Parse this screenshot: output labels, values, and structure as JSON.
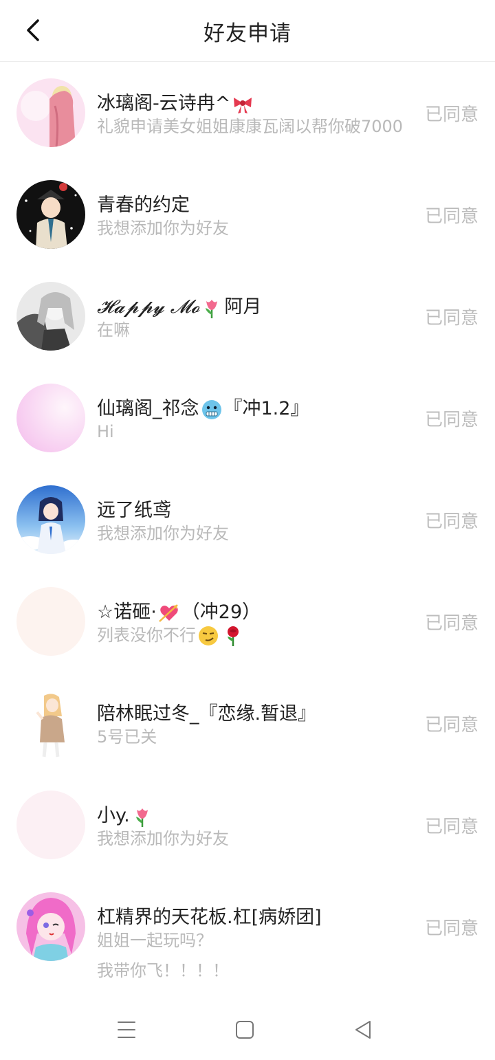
{
  "header": {
    "title": "好友申请"
  },
  "requests": [
    {
      "name": "冰璃阁-云诗冉^",
      "emoji": "🎀",
      "message": "礼貌申请美女姐姐康康瓦阔以帮你破7000",
      "status": "已同意",
      "avatar_color": "#f7c6e0"
    },
    {
      "name": "青春的约定",
      "message": "我想添加你为好友",
      "status": "已同意",
      "avatar_color": "#1a1a1a"
    },
    {
      "name": "𝓗𝓪𝓹𝓹𝔂 𝓜𝓸",
      "emoji": "🌷",
      "name_suffix": "阿月",
      "message": "在嘛",
      "status": "已同意",
      "avatar_color": "#d8d8d8"
    },
    {
      "name": "仙璃阁_祁念",
      "emoji": "🥶",
      "name_suffix": "『冲1.2』",
      "message": "Hi",
      "status": "已同意",
      "avatar_color": "#f8d2f2"
    },
    {
      "name": "远了纸鸢",
      "message": "我想添加你为好友",
      "status": "已同意",
      "avatar_color": "#3a7bd5"
    },
    {
      "name": "☆诺砸·",
      "emoji": "💘",
      "name_suffix": "（冲29）",
      "message": "列表没你不行",
      "msg_emoji1": "😏",
      "msg_emoji2": "🌹",
      "status": "已同意",
      "avatar_color": "#fdf1ee"
    },
    {
      "name": "陪林眠过冬_『恋缘.暂退』",
      "message": "5号已关",
      "status": "已同意",
      "avatar_color": "#e9cfa8"
    },
    {
      "name": "小y.",
      "emoji": "🌷",
      "message": "我想添加你为好友",
      "status": "已同意",
      "avatar_color": "#fbeff3"
    },
    {
      "name": "杠精界的天花板.杠[病娇团]",
      "message": "姐姐一起玩吗？",
      "message_line2": "我带你飞！！！！",
      "status": "已同意",
      "avatar_color": "#f49ad4"
    }
  ],
  "colors": {
    "title": "#222222",
    "message": "#b9b9b9",
    "status": "#bdbdbd",
    "divider": "#ececec"
  }
}
